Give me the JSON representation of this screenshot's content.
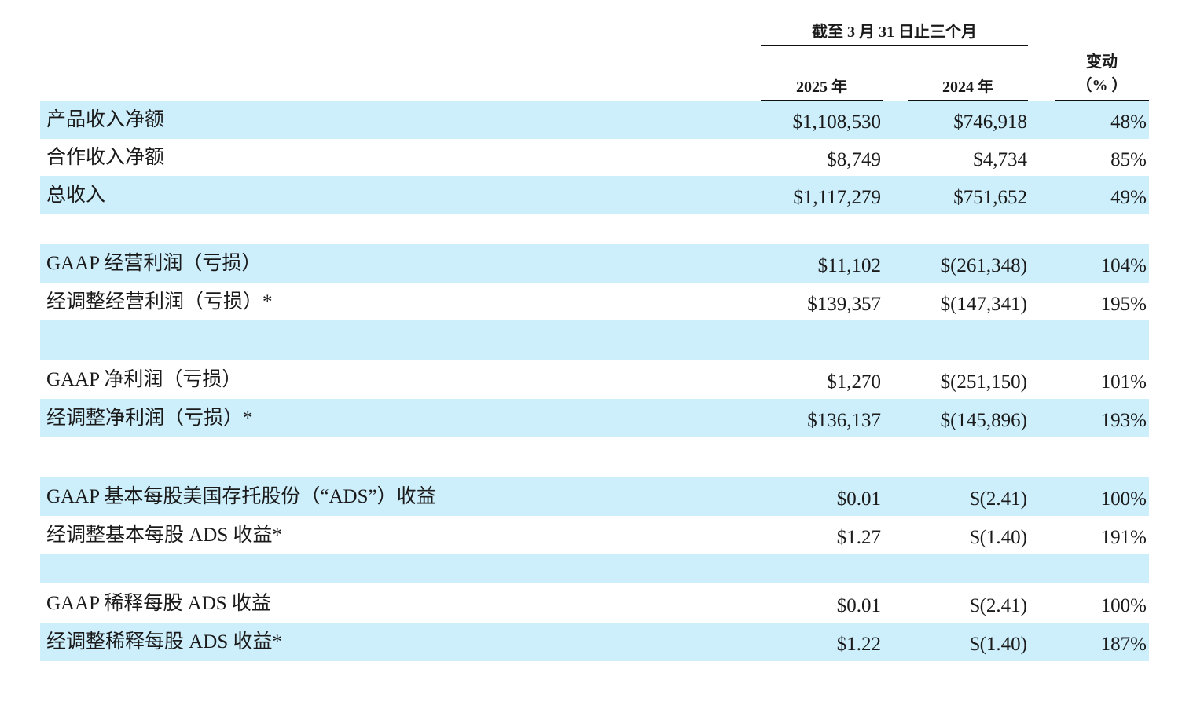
{
  "header": {
    "period": "截至 3 月 31 日止三个月",
    "year_current": "2025 年",
    "year_prior": "2024 年",
    "change_line1": "变动",
    "change_line2": "（% ）"
  },
  "rows": [
    {
      "label": "产品收入净额",
      "v2025": "$1,108,530",
      "v2024": "$746,918",
      "change": "48%"
    },
    {
      "label": "合作收入净额",
      "v2025": "$8,749",
      "v2024": "$4,734",
      "change": "85%"
    },
    {
      "label": "总收入",
      "v2025": "$1,117,279",
      "v2024": "$751,652",
      "change": "49%"
    },
    {
      "label": "GAAP 经营利润（亏损）",
      "v2025": "$11,102",
      "v2024": "$(261,348)",
      "change": "104%"
    },
    {
      "label": "经调整经营利润（亏损）*",
      "v2025": "$139,357",
      "v2024": "$(147,341)",
      "change": "195%"
    },
    {
      "label": "GAAP 净利润（亏损）",
      "v2025": "$1,270",
      "v2024": "$(251,150)",
      "change": "101%"
    },
    {
      "label": "经调整净利润（亏损）*",
      "v2025": "$136,137",
      "v2024": "$(145,896)",
      "change": "193%"
    },
    {
      "label": "GAAP 基本每股美国存托股份（“ADS”）收益",
      "v2025": "$0.01",
      "v2024": "$(2.41)",
      "change": "100%"
    },
    {
      "label": "经调整基本每股 ADS 收益*",
      "v2025": "$1.27",
      "v2024": "$(1.40)",
      "change": "191%"
    },
    {
      "label": "GAAP 稀释每股 ADS 收益",
      "v2025": "$0.01",
      "v2024": "$(2.41)",
      "change": "100%"
    },
    {
      "label": "经调整稀释每股 ADS 收益*",
      "v2025": "$1.22",
      "v2024": "$(1.40)",
      "change": "187%"
    }
  ],
  "colors": {
    "row_shade": "#cdeefb",
    "rule": "#111111",
    "text": "#1a1a1a"
  }
}
